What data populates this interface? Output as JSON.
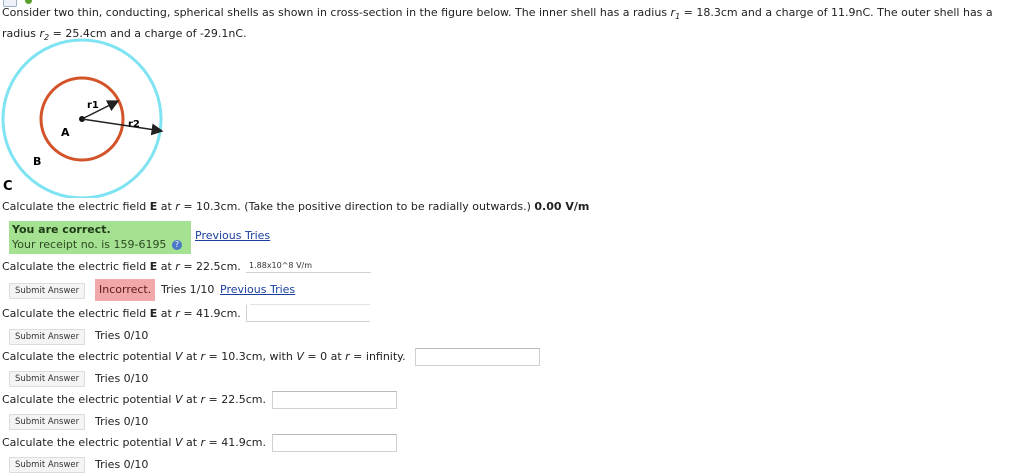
{
  "problem": {
    "part1": "Consider two thin, conducting, spherical shells as shown in cross-section in the figure below. The inner shell has a radius ",
    "r1_label": "r",
    "r1_sub": "1",
    "part2": " = 18.3cm and a charge of 11.9nC. The outer shell has a radius ",
    "r2_label": "r",
    "r2_sub": "2",
    "part3": " = 25.4cm and a charge of -29.1nC."
  },
  "figure": {
    "label_r1": "r1",
    "label_r2": "r2",
    "label_a": "A",
    "label_b": "B",
    "label_c": "C",
    "inner_color": "#d4542a",
    "outer_color": "#7fe3f2"
  },
  "q1": {
    "text_a": "Calculate the electric field ",
    "E": "E",
    "text_b": " at ",
    "r": "r",
    "text_c": " = 10.3cm. (Take the positive direction to be radially outwards.) ",
    "answer": "0.00 V/m",
    "status_title": "You are correct.",
    "status_receipt": "Your receipt no. is 159-6195",
    "prev_tries": "Previous Tries"
  },
  "q2": {
    "text_a": "Calculate the electric field ",
    "E": "E",
    "text_b": " at ",
    "r": "r",
    "text_c": " = 22.5cm.",
    "input_value": "1.88x10^8 V/m",
    "submit": "Submit Answer",
    "status": "Incorrect.",
    "tries": "Tries 1/10",
    "prev_tries": "Previous Tries"
  },
  "q3": {
    "text_a": "Calculate the electric field ",
    "E": "E",
    "text_b": " at ",
    "r": "r",
    "text_c": " = 41.9cm.",
    "submit": "Submit Answer",
    "tries": "Tries 0/10"
  },
  "q4": {
    "text_a": "Calculate the electric potential ",
    "V": "V",
    "text_b": " at ",
    "r": "r",
    "text_c": " = 10.3cm, with ",
    "V2": "V",
    "text_d": " = 0 at ",
    "r2": "r",
    "text_e": " = infinity.",
    "submit": "Submit Answer",
    "tries": "Tries 0/10"
  },
  "q5": {
    "text_a": "Calculate the electric potential ",
    "V": "V",
    "text_b": " at ",
    "r": "r",
    "text_c": " = 22.5cm.",
    "submit": "Submit Answer",
    "tries": "Tries 0/10"
  },
  "q6": {
    "text_a": "Calculate the electric potential ",
    "V": "V",
    "text_b": " at ",
    "r": "r",
    "text_c": " = 41.9cm.",
    "submit": "Submit Answer",
    "tries": "Tries 0/10"
  }
}
